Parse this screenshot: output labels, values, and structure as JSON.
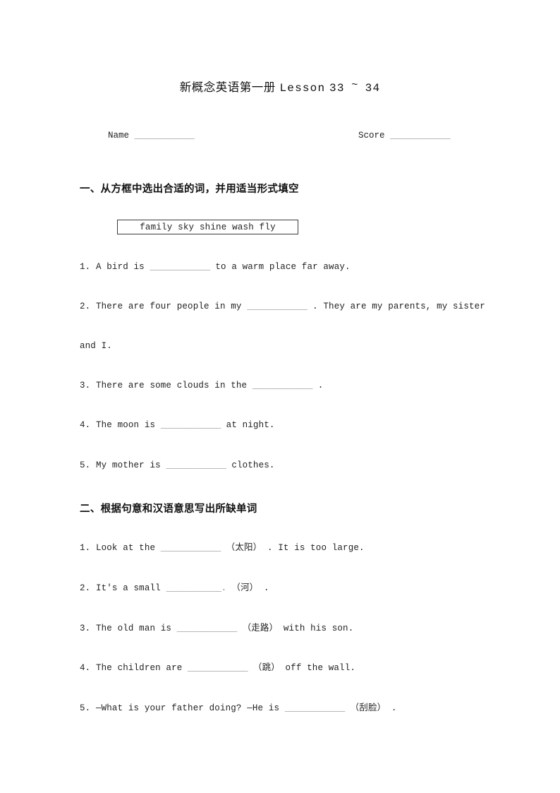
{
  "document": {
    "title_cjk": "新概念英语第一册",
    "title_lesson_prefix": "Lesson",
    "title_lesson_from": "33",
    "title_lesson_tilde": "~",
    "title_lesson_to": "34"
  },
  "meta": {
    "name_label": "Name",
    "name_blank": "____________",
    "score_label": "Score",
    "score_blank": "____________"
  },
  "section1": {
    "heading": "一、从方框中选出合适的词，并用适当形式填空",
    "word_bank": "family  sky  shine  wash  fly",
    "word_bank_items": [
      "family",
      "sky",
      "shine",
      "wash",
      "fly"
    ],
    "questions": [
      {
        "number": "1.",
        "before": "A bird is",
        "blank": "____________",
        "after": "to a warm place far away."
      },
      {
        "number": "2.",
        "before": "There are four people in my",
        "blank": "____________",
        "after": ". They are my parents, my sister",
        "wrap": "and I."
      },
      {
        "number": "3.",
        "before": "There are some clouds in the",
        "blank": "____________",
        "after": "."
      },
      {
        "number": "4.",
        "before": "The moon is",
        "blank": "____________",
        "after": "at night."
      },
      {
        "number": "5.",
        "before": "My mother is",
        "blank": "____________",
        "after": "clothes."
      }
    ]
  },
  "section2": {
    "heading": "二、根据句意和汉语意思写出所缺单词",
    "questions": [
      {
        "number": "1.",
        "before": "Look at the",
        "blank": "____________",
        "hint": "（太阳）",
        "after": ". It is too large."
      },
      {
        "number": "2.",
        "before": "It's a small",
        "blank": "___________.",
        "hint": "（河）",
        "after": "."
      },
      {
        "number": "3.",
        "before": "The old man is",
        "blank": "____________",
        "hint": "（走路）",
        "after": "with his son."
      },
      {
        "number": "4.",
        "before": "The children are",
        "blank": "____________",
        "hint": "（跳）",
        "after": "off the wall."
      },
      {
        "number": "5.",
        "before": "—What is your father doing? —He is",
        "blank": "____________",
        "hint": "（刮脸）",
        "after": "."
      }
    ]
  }
}
